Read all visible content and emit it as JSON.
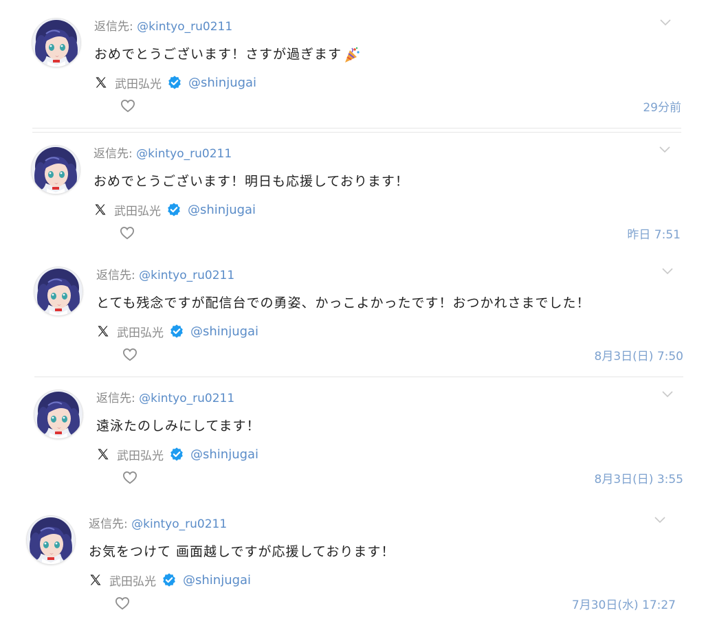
{
  "posts": [
    {
      "reply_label": "返信先: ",
      "reply_handle": "@kintyo_ru0211",
      "content": "おめでとうございます！さすが過ぎます",
      "emoji": "party-popper-icon",
      "author_name": "武田弘光",
      "author_handle": "@shinjugai",
      "time": "29分前"
    },
    {
      "reply_label": "返信先: ",
      "reply_handle": "@kintyo_ru0211",
      "content": "おめでとうございます！明日も応援しております！",
      "author_name": "武田弘光",
      "author_handle": "@shinjugai",
      "time": "昨日 7:51"
    },
    {
      "reply_label": "返信先: ",
      "reply_handle": "@kintyo_ru0211",
      "content": "とても残念ですが配信台での勇姿、かっこよかったです！おつかれさまでした！",
      "author_name": "武田弘光",
      "author_handle": "@shinjugai",
      "time": "8月3日(日) 7:50"
    },
    {
      "reply_label": "返信先: ",
      "reply_handle": "@kintyo_ru0211",
      "content": "遠泳たのしみにしてます！",
      "author_name": "武田弘光",
      "author_handle": "@shinjugai",
      "time": "8月3日(日) 3:55"
    },
    {
      "reply_label": "返信先: ",
      "reply_handle": "@kintyo_ru0211",
      "content": "お気をつけて 画面越しですが応援しております！",
      "author_name": "武田弘光",
      "author_handle": "@shinjugai",
      "time": "7月30日(水) 17:27"
    }
  ],
  "colors": {
    "link": "#5a8cc8",
    "timestamp": "#7ea2cf",
    "muted": "#8a8a8a",
    "verified": "#1d9bf0",
    "divider": "#e6e6e6"
  },
  "icons": {
    "avatar": "anime-avatar",
    "platform": "x-logo-icon",
    "verified": "verified-badge-icon",
    "like": "heart-outline-icon",
    "menu": "chevron-down-icon"
  }
}
